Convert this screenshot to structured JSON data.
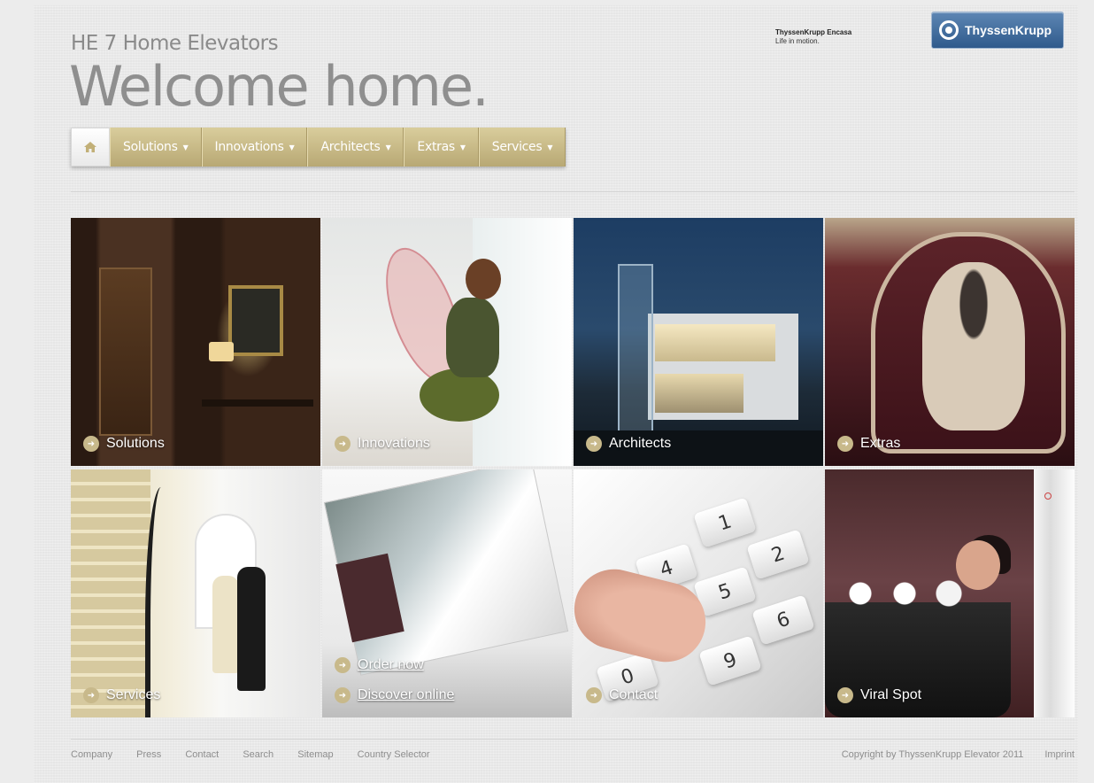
{
  "header": {
    "subtitle": "HE 7 Home Elevators",
    "headline": "Welcome home.",
    "brand_tagline_title": "ThyssenKrupp Encasa",
    "brand_tagline_sub": "Life in motion.",
    "brand_logo_text": "ThyssenKrupp"
  },
  "nav": {
    "home_icon": "home-icon",
    "items": [
      {
        "label": "Solutions"
      },
      {
        "label": "Innovations"
      },
      {
        "label": "Architects"
      },
      {
        "label": "Extras"
      },
      {
        "label": "Services"
      }
    ]
  },
  "tiles": [
    {
      "label": "Solutions"
    },
    {
      "label": "Innovations"
    },
    {
      "label": "Architects"
    },
    {
      "label": "Extras"
    },
    {
      "label": "Services"
    },
    {
      "label_1": "Order now",
      "label_2": "Discover online"
    },
    {
      "label": "Contact"
    },
    {
      "label": "Viral Spot"
    }
  ],
  "keypad": {
    "keys": [
      "1",
      "2",
      "4",
      "5",
      "6",
      "9",
      "0"
    ]
  },
  "footer": {
    "links": [
      "Company",
      "Press",
      "Contact",
      "Search",
      "Sitemap",
      "Country Selector"
    ],
    "copyright": "Copyright by ThyssenKrupp Elevator 2011",
    "imprint": "Imprint"
  },
  "colors": {
    "nav_gold": "#c8b98b",
    "page_background": "#e6e6e6",
    "brand_blue": "#2f5a8c"
  }
}
